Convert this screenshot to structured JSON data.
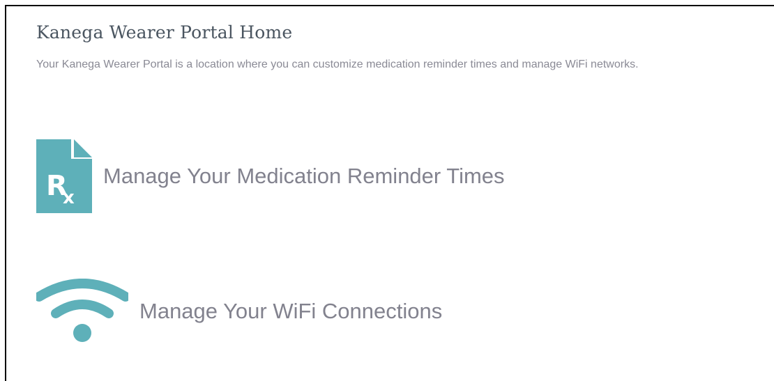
{
  "page": {
    "title": "Kanega Wearer Portal Home",
    "description": "Your Kanega Wearer Portal is a location where you can customize medication reminder times and manage WiFi networks."
  },
  "links": {
    "medication": {
      "label": "Manage Your Medication Reminder Times",
      "icon": "prescription-document-icon",
      "icon_text": "R",
      "icon_sub": "x"
    },
    "wifi": {
      "label": "Manage Your WiFi Connections",
      "icon": "wifi-icon"
    }
  },
  "colors": {
    "accent": "#5eb0b9",
    "title": "#4a5560",
    "muted": "#8a8a95",
    "link_text": "#82828e"
  }
}
